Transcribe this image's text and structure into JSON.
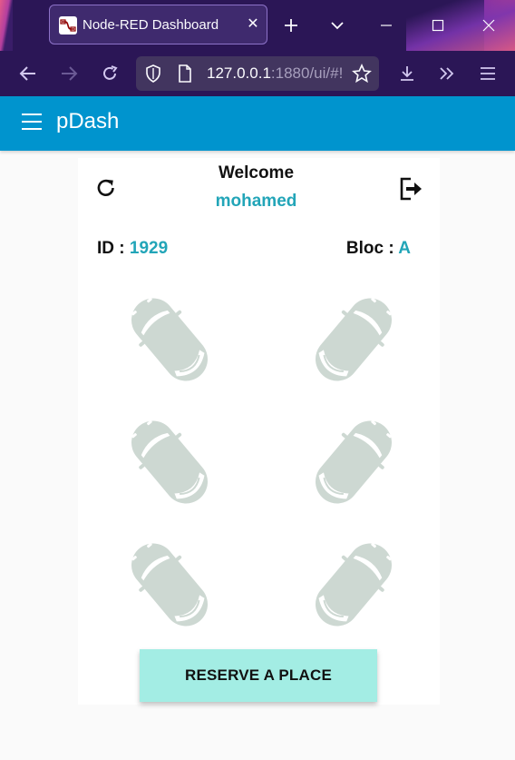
{
  "browser": {
    "tab_title": "Node-RED Dashboard",
    "url_host": "127.0.0.1",
    "url_rest": ":1880/ui/#!/",
    "icons": [
      "close-icon",
      "new-tab-icon",
      "tab-list-icon",
      "minimize-icon",
      "maximize-icon",
      "window-close-icon",
      "back-icon",
      "forward-icon",
      "reload-icon",
      "shield-icon",
      "page-icon",
      "bookmark-star-icon",
      "download-icon",
      "overflow-icon",
      "menu-icon"
    ]
  },
  "app": {
    "title": "pDash",
    "accent_color": "#0094ce"
  },
  "card": {
    "welcome_label": "Welcome",
    "username": "mohamed",
    "id_label": "ID : ",
    "id_value": "1929",
    "bloc_label": "Bloc : ",
    "bloc_value": "A",
    "highlight_color": "#22a5b8",
    "parking_spots": [
      {
        "status": "available",
        "icon": "car-icon"
      },
      {
        "status": "available",
        "icon": "car-icon"
      },
      {
        "status": "available",
        "icon": "car-icon"
      },
      {
        "status": "available",
        "icon": "car-icon"
      },
      {
        "status": "available",
        "icon": "car-icon"
      },
      {
        "status": "available",
        "icon": "car-icon"
      }
    ],
    "reserve_label": "RESERVE A PLACE"
  }
}
